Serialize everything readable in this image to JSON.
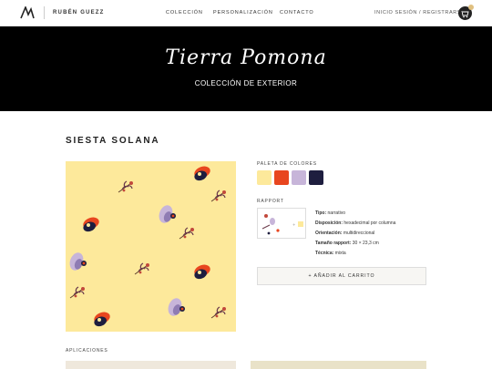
{
  "header": {
    "brand": "RUBÉN GUEZZ",
    "nav": [
      "COLECCIÓN",
      "PERSONALIZACIÓN",
      "CONTACTO"
    ],
    "login": "INICIO SESIÓN / REGISTRARSE"
  },
  "hero": {
    "title": "Tierra Pomona",
    "subtitle": "COLECCIÓN DE EXTERIOR"
  },
  "product": {
    "title": "SIESTA SOLANA",
    "palette_label": "PALETA DE COLORES",
    "palette": [
      "#fde99b",
      "#e8461f",
      "#c7b5d9",
      "#1e1e3f"
    ],
    "rapport_label": "RAPPORT",
    "specs": [
      {
        "key": "Tipo:",
        "value": "narrativo"
      },
      {
        "key": "Disposición:",
        "value": "hexadecimal por columna"
      },
      {
        "key": "Orientación:",
        "value": "multidireccional"
      },
      {
        "key": "Tamaño rapport:",
        "value": "30 × 23,3 cm"
      },
      {
        "key": "Técnica:",
        "value": "mixta"
      }
    ],
    "add_to_cart": "+ AÑADIR AL CARRITO"
  },
  "applications_label": "APLICACIONES"
}
